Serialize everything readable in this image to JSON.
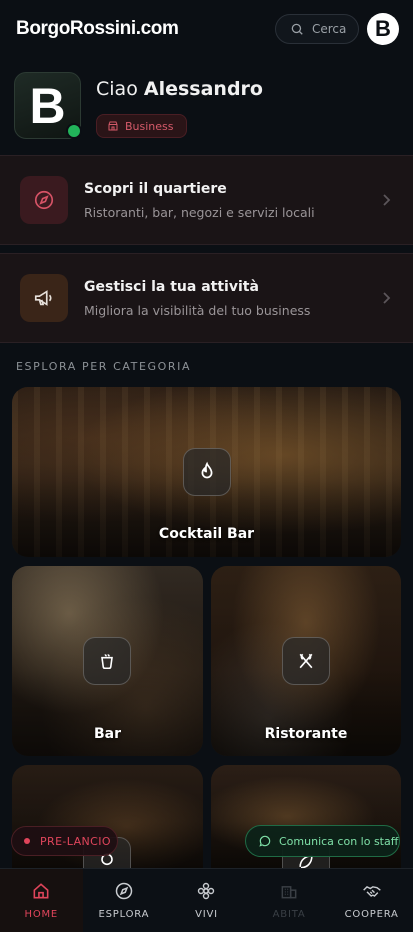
{
  "header": {
    "brand": "BorgoRossini.com",
    "search_label": "Cerca",
    "avatar_letter": "B"
  },
  "profile": {
    "avatar_letter": "B",
    "greeting": "Ciao",
    "name": "Alessandro",
    "badge": "Business"
  },
  "cards": [
    {
      "title": "Scopri il quartiere",
      "subtitle": "Ristoranti, bar, negozi e servizi locali",
      "icon": "compass-icon"
    },
    {
      "title": "Gestisci la tua attività",
      "subtitle": "Migliora la visibilità del tuo business",
      "icon": "megaphone-icon"
    }
  ],
  "section_title": "ESPLORA PER CATEGORIA",
  "categories": [
    {
      "label": "Cocktail Bar",
      "icon": "flame-icon"
    },
    {
      "label": "Bar",
      "icon": "cup-icon"
    },
    {
      "label": "Ristorante",
      "icon": "utensils-icon"
    }
  ],
  "floating": {
    "prelaunch": "PRE-LANCIO",
    "staff": "Comunica con lo staff"
  },
  "nav": [
    {
      "label": "HOME",
      "icon": "home-icon",
      "state": "active"
    },
    {
      "label": "ESPLORA",
      "icon": "compass-icon",
      "state": "normal"
    },
    {
      "label": "VIVI",
      "icon": "flower-icon",
      "state": "normal"
    },
    {
      "label": "ABITA",
      "icon": "building-icon",
      "state": "disabled"
    },
    {
      "label": "COOPERA",
      "icon": "handshake-icon",
      "state": "normal"
    }
  ],
  "colors": {
    "accent": "#e0455b",
    "online": "#22b45a",
    "staff": "#7fe0a8",
    "background": "#0b0f14"
  }
}
